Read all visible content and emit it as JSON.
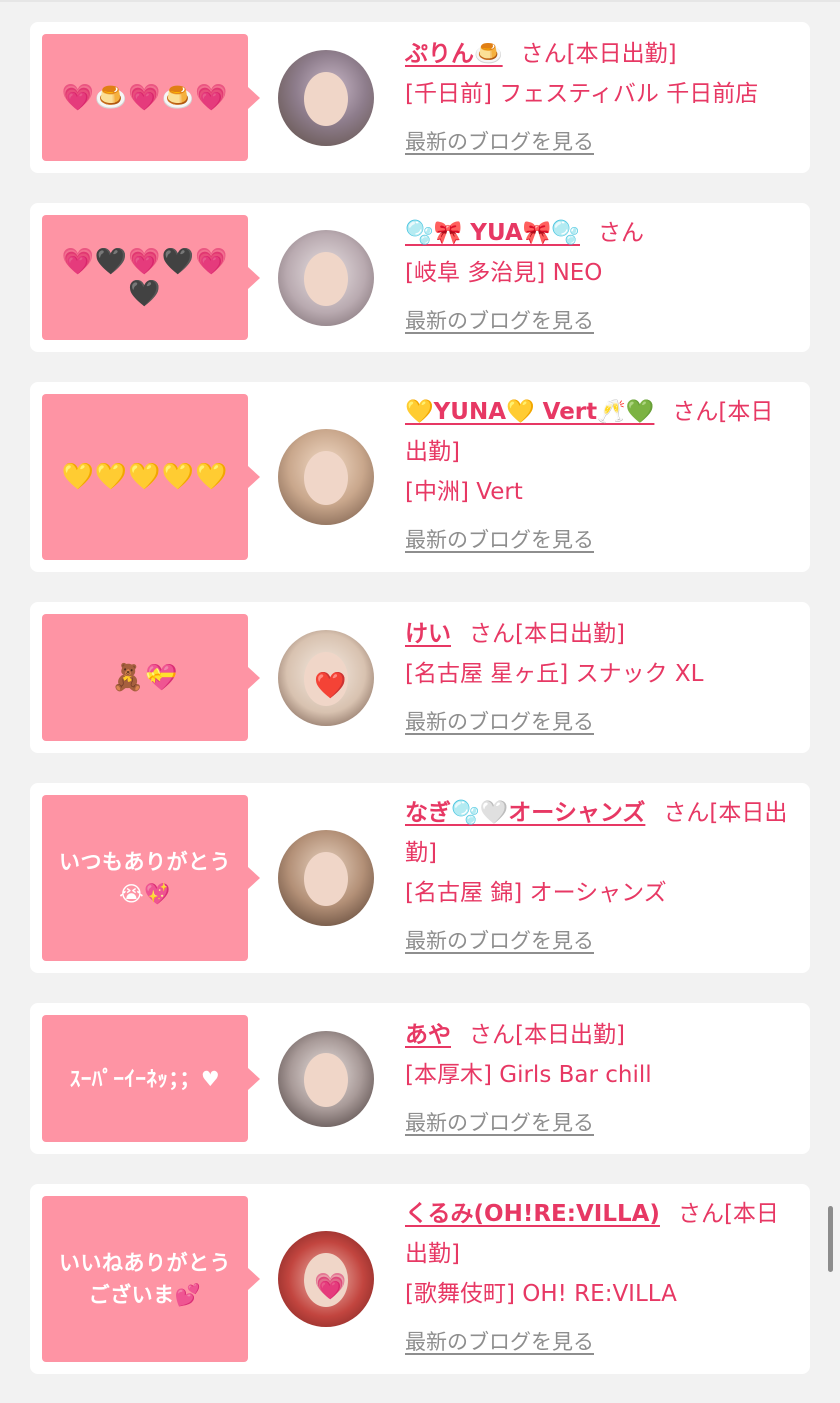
{
  "blog_link_label": "最新のブログを見る",
  "colors": {
    "accent": "#e73864",
    "bubble": "#fe94a4",
    "background": "#f2f2f2",
    "card": "#ffffff",
    "link_gray": "#8e8e8e"
  },
  "cards": [
    {
      "message": "💗🍮💗🍮💗",
      "name": "ぷりん🍮",
      "suffix": "さん[本日出勤]",
      "shop": "[千日前] フェスティバル 千日前店",
      "avatar_icon": "profile-photo-icon"
    },
    {
      "message": "💗🖤💗🖤💗🖤",
      "name": "🫧🎀 YUA🎀🫧",
      "suffix": "さん",
      "shop": "[岐阜 多治見] NEO",
      "avatar_icon": "profile-photo-icon"
    },
    {
      "message": "💛💛💛💛💛",
      "name": "💛YUNA💛 Vert🥂💚",
      "suffix": "さん[本日出勤]",
      "shop": "[中洲] Vert",
      "avatar_icon": "profile-photo-icon"
    },
    {
      "message": "🧸💝",
      "name": "けい",
      "suffix": "さん[本日出勤]",
      "shop": "[名古屋 星ヶ丘] スナック XL",
      "avatar_icon": "profile-photo-icon",
      "avatar_sticker": "❤️"
    },
    {
      "message": "いつもありがとう😭💖",
      "name": "なぎ🫧🤍オーシャンズ",
      "suffix": "さん[本日出勤]",
      "shop": "[名古屋 錦] オーシャンズ",
      "avatar_icon": "profile-photo-icon"
    },
    {
      "message": "ｽｰﾊﾟｰｲｰﾈｯ；；♥",
      "name": "あや",
      "suffix": "さん[本日出勤]",
      "shop": "[本厚木] Girls Bar chill",
      "avatar_icon": "profile-photo-icon"
    },
    {
      "message": "いいねありがとうございま💕",
      "name": "くるみ(OH!RE:VILLA)",
      "suffix": "さん[本日出勤]",
      "shop": "[歌舞伎町] OH! RE:VILLA",
      "avatar_icon": "profile-photo-icon",
      "avatar_sticker": "💗"
    }
  ]
}
